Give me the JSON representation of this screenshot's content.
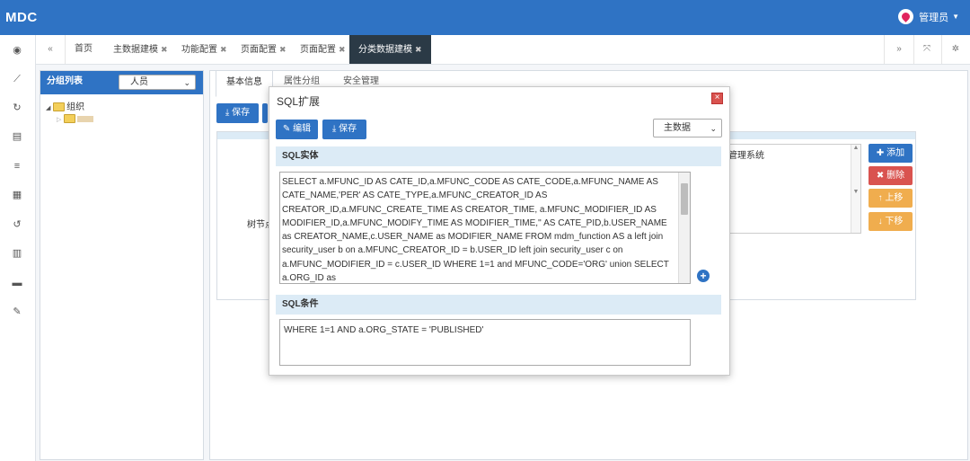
{
  "app": {
    "logo": "MDC",
    "user": "管理员"
  },
  "tabs": {
    "items": [
      "首页",
      "主数据建模",
      "功能配置",
      "页面配置",
      "页面配置",
      "分类数据建模"
    ],
    "active_index": 5
  },
  "group_panel": {
    "title": "分组列表",
    "select_value": "人员",
    "tree": {
      "root": "组织",
      "child": ""
    }
  },
  "main": {
    "tabs": [
      "基本信息",
      "属性分组",
      "安全管理"
    ],
    "save_label": "保存",
    "tree_node_label": "树节点",
    "list_value": "明管理系统",
    "buttons": {
      "add": "添加",
      "delete": "删除",
      "up": "上移",
      "down": "下移"
    }
  },
  "modal": {
    "title": "SQL扩展",
    "edit_label": "编辑",
    "save_label": "保存",
    "select_value": "主数据",
    "sql_entity_title": "SQL实体",
    "sql_entity_text": " SELECT a.MFUNC_ID AS CATE_ID,a.MFUNC_CODE AS CATE_CODE,a.MFUNC_NAME AS CATE_NAME,'PER' AS CATE_TYPE,a.MFUNC_CREATOR_ID AS CREATOR_ID,a.MFUNC_CREATE_TIME AS CREATOR_TIME, a.MFUNC_MODIFIER_ID AS MODIFIER_ID,a.MFUNC_MODIFY_TIME AS MODIFIER_TIME,'' AS CATE_PID,b.USER_NAME as CREATOR_NAME,c.USER_NAME as MODIFIER_NAME FROM mdm_function AS a left join security_user b on a.MFUNC_CREATOR_ID = b.USER_ID left join security_user c on a.MFUNC_MODIFIER_ID = c.USER_ID WHERE 1=1 and MFUNC_CODE='ORG' union  SELECT a.ORG_ID as",
    "sql_condition_title": "SQL条件",
    "sql_condition_text": "WHERE 1=1 AND a.ORG_STATE = 'PUBLISHED'"
  },
  "colors": {
    "primary": "#2f73c4",
    "danger": "#d9534f",
    "warning": "#f0ad4e",
    "active_tab": "#2b3a46",
    "section": "#dcebf6"
  }
}
